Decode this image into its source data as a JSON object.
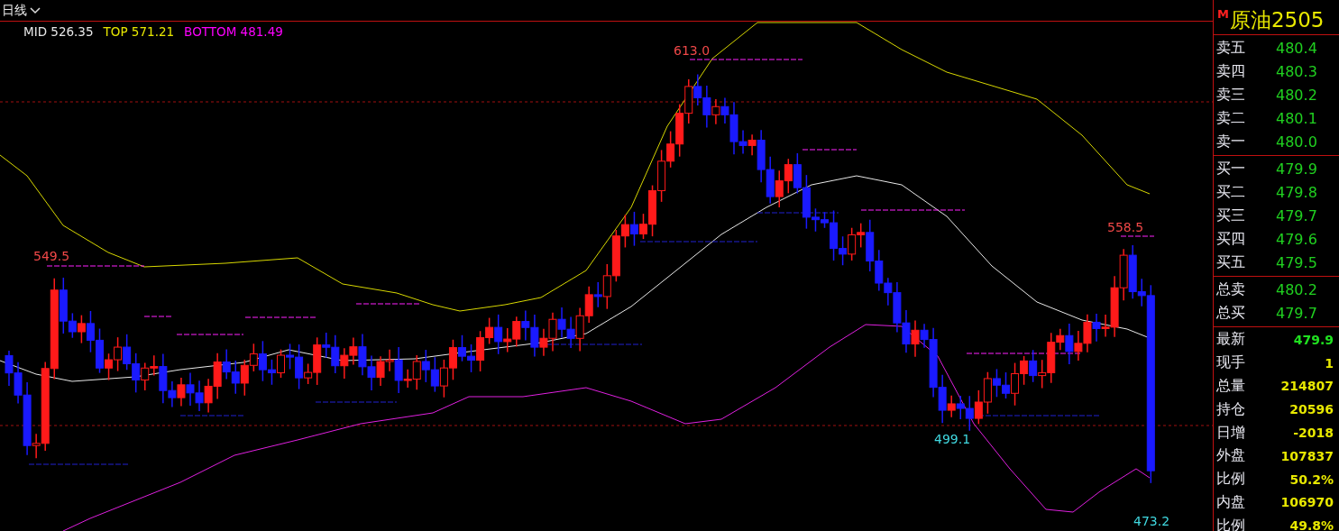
{
  "period": {
    "label": "日线"
  },
  "legend": {
    "items": [
      {
        "kind": "mid",
        "text": "MID 526.35"
      },
      {
        "kind": "top",
        "text": "TOP 571.21"
      },
      {
        "kind": "bottom",
        "text": "BOTTOM 481.49"
      }
    ]
  },
  "chart": {
    "price_labels": [
      {
        "kind": "high",
        "text": "613.0"
      },
      {
        "kind": "high",
        "text": "549.5"
      },
      {
        "kind": "high",
        "text": "558.5"
      },
      {
        "kind": "low",
        "text": "499.1"
      },
      {
        "kind": "low",
        "text": "473.2"
      }
    ]
  },
  "quote": {
    "flag": "M",
    "symbol": "原油2505",
    "asks": [
      {
        "label": "卖五",
        "price": "480.4"
      },
      {
        "label": "卖四",
        "price": "480.3"
      },
      {
        "label": "卖三",
        "price": "480.2"
      },
      {
        "label": "卖二",
        "price": "480.1"
      },
      {
        "label": "卖一",
        "price": "480.0"
      }
    ],
    "bids": [
      {
        "label": "买一",
        "price": "479.9"
      },
      {
        "label": "买二",
        "price": "479.8"
      },
      {
        "label": "买三",
        "price": "479.7"
      },
      {
        "label": "买四",
        "price": "479.6"
      },
      {
        "label": "买五",
        "price": "479.5"
      }
    ],
    "totals": [
      {
        "label": "总卖",
        "price": "480.2"
      },
      {
        "label": "总买",
        "price": "479.7"
      }
    ],
    "stats": [
      {
        "label": "最新",
        "value": "479.9",
        "kind": "price"
      },
      {
        "label": "现手",
        "value": "1",
        "kind": "number"
      },
      {
        "label": "总量",
        "value": "214807",
        "kind": "number"
      },
      {
        "label": "持仓",
        "value": "20596",
        "kind": "number"
      },
      {
        "label": "日增",
        "value": "-2018",
        "kind": "number"
      },
      {
        "label": "外盘",
        "value": "107837",
        "kind": "number"
      },
      {
        "label": "比例",
        "value": "50.2%",
        "kind": "number"
      },
      {
        "label": "内盘",
        "value": "106970",
        "kind": "number"
      },
      {
        "label": "比例",
        "value": "49.8%",
        "kind": "number"
      }
    ]
  }
}
